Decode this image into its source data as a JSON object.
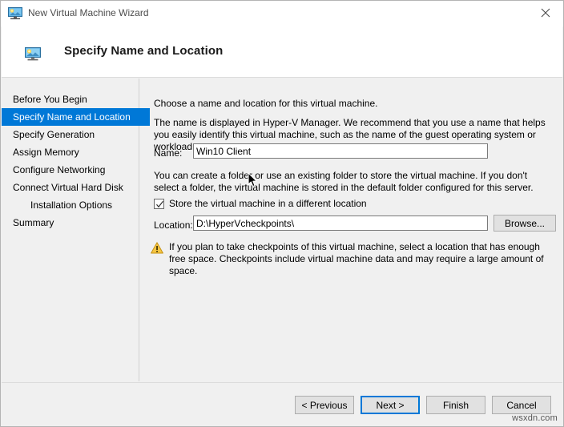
{
  "window": {
    "title": "New Virtual Machine Wizard",
    "title_icon": "virtual-machine-monitor-icon",
    "close_icon": "close-icon",
    "accent_color": "#0078d7",
    "background_color": "#f0f0f0"
  },
  "header": {
    "icon": "virtual-machine-monitor-icon",
    "title": "Specify Name and Location"
  },
  "sidebar": {
    "items": [
      {
        "label": "Before You Begin",
        "selected": false,
        "indented": false
      },
      {
        "label": "Specify Name and Location",
        "selected": true,
        "indented": false
      },
      {
        "label": "Specify Generation",
        "selected": false,
        "indented": false
      },
      {
        "label": "Assign Memory",
        "selected": false,
        "indented": false
      },
      {
        "label": "Configure Networking",
        "selected": false,
        "indented": false
      },
      {
        "label": "Connect Virtual Hard Disk",
        "selected": false,
        "indented": false
      },
      {
        "label": "Installation Options",
        "selected": false,
        "indented": true
      },
      {
        "label": "Summary",
        "selected": false,
        "indented": false
      }
    ]
  },
  "content": {
    "intro": "Choose a name and location for this virtual machine.",
    "description": "The name is displayed in Hyper-V Manager. We recommend that you use a name that helps you easily identify this virtual machine, such as the name of the guest operating system or workload.",
    "name_label": "Name:",
    "name_value": "Win10 Client",
    "name_placeholder": "",
    "folder_text": "You can create a folder or use an existing folder to store the virtual machine. If you don't select a folder, the virtual machine is stored in the default folder configured for this server.",
    "checkbox_label": "Store the virtual machine in a different location",
    "checkbox_checked": true,
    "location_label": "Location:",
    "location_value": "D:\\HyperVcheckpoints\\",
    "location_placeholder": "",
    "browse_label": "Browse...",
    "warning_icon": "warning-triangle-icon",
    "warning_color": "#f0b400",
    "warning_text": "If you plan to take checkpoints of this virtual machine, select a location that has enough free space. Checkpoints include virtual machine data and may require a large amount of space."
  },
  "footer": {
    "previous_label": "< Previous",
    "next_label": "Next >",
    "finish_label": "Finish",
    "cancel_label": "Cancel",
    "default_button": "Next >"
  },
  "watermark": "wsxdn.com"
}
